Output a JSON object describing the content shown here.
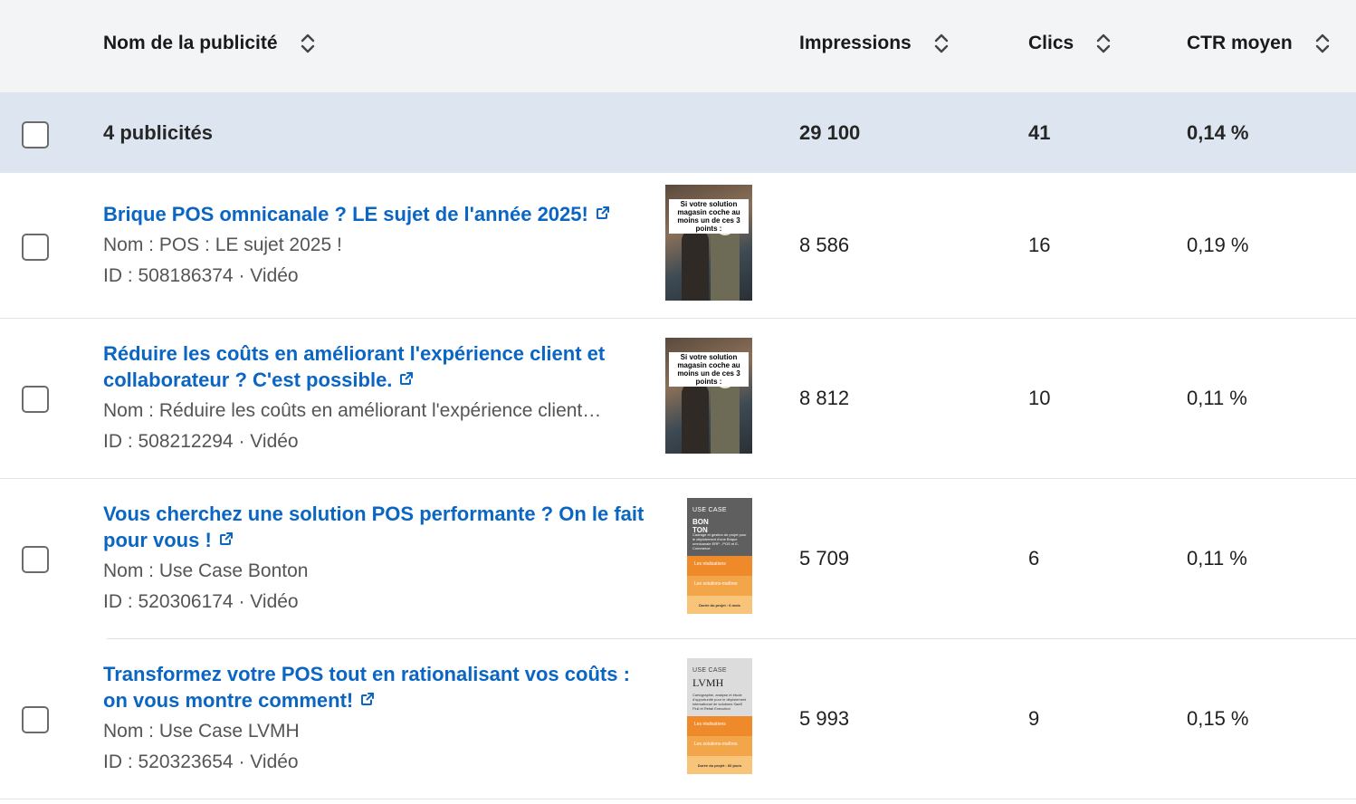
{
  "header": {
    "columns": [
      {
        "label": "Nom de la publicité"
      },
      {
        "label": "Impressions"
      },
      {
        "label": "Clics"
      },
      {
        "label": "CTR moyen"
      }
    ]
  },
  "summary": {
    "label": "4 publicités",
    "impressions": "29 100",
    "clicks": "41",
    "ctr": "0,14 %"
  },
  "rows": [
    {
      "title": "Brique POS omnicanale ? LE sujet de l'année 2025!",
      "name": "Nom : POS : LE sujet 2025 !",
      "id": "ID : 508186374 · Vidéo",
      "impressions": "8 586",
      "clicks": "16",
      "ctr": "0,19 %",
      "thumb_caption": "Si votre solution magasin coche au moins un de ces 3 points :"
    },
    {
      "title": "Réduire les coûts en améliorant l'expérience client et collaborateur ? C'est possible.",
      "name": "Nom : Réduire les coûts en améliorant l'expérience client…",
      "id": "ID : 508212294 · Vidéo",
      "impressions": "8 812",
      "clicks": "10",
      "ctr": "0,11 %",
      "thumb_caption": "Si votre solution magasin coche au moins un de ces 3 points :"
    },
    {
      "title": "Vous cherchez une solution POS performante ? On le fait pour vous !",
      "name": "Nom : Use Case Bonton",
      "id": "ID : 520306174 · Vidéo",
      "impressions": "5 709",
      "clicks": "6",
      "ctr": "0,11 %",
      "thumb_label": "USE CASE",
      "thumb_brand": "BON TON",
      "thumb_text": "Cadrage et gestion de projet pour le déploiement d'une Brique omnicanale ERP - POS et E-Commerce",
      "thumb_band1": "Les réalisations",
      "thumb_band2": "Les solutions-maîtres",
      "thumb_footer": "Durée du projet : 6 mois"
    },
    {
      "title": "Transformez votre POS tout en rationalisant vos coûts : on vous montre comment!",
      "name": "Nom : Use Case LVMH",
      "id": "ID : 520323654 · Vidéo",
      "impressions": "5 993",
      "clicks": "9",
      "ctr": "0,15 %",
      "thumb_label": "USE CASE",
      "thumb_brand": "LVMH",
      "thumb_text": "Cartographie, analyse et étude d'opportunité pour le déploiement international de solutions SaaS Fluii et Retail Execution",
      "thumb_band1": "Les réalisations",
      "thumb_band2": "Les solutions-maîtres",
      "thumb_footer": "Durée du projet : 60 jours"
    }
  ],
  "colors": {
    "link": "#0a66c2",
    "header_bg": "#f3f4f6",
    "summary_bg": "#dde6f0",
    "orange": "#f0912f"
  }
}
